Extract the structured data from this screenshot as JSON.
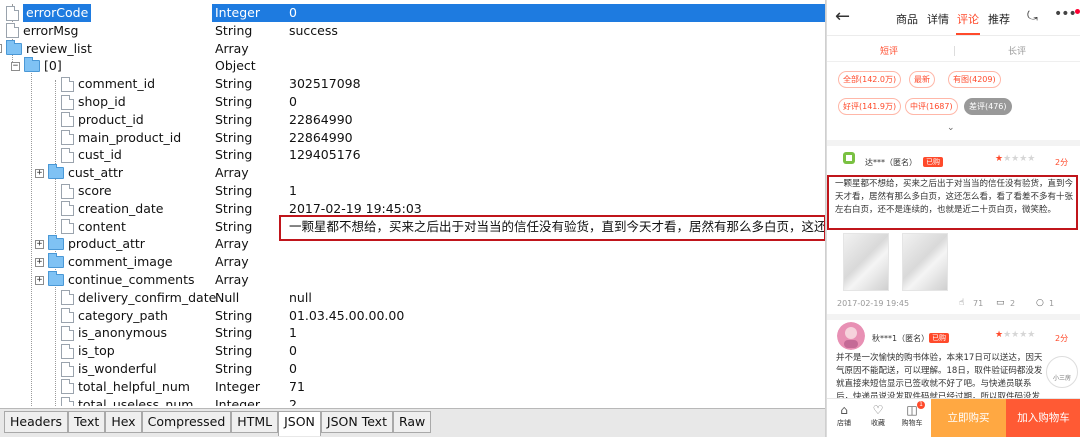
{
  "json_viewer": {
    "rows": [
      {
        "key": "errorCode",
        "type": "Integer",
        "value": "0"
      },
      {
        "key": "errorMsg",
        "type": "String",
        "value": "success"
      },
      {
        "key": "review_list",
        "type": "Array",
        "value": ""
      },
      {
        "key": "[0]",
        "type": "Object",
        "value": ""
      },
      {
        "key": "comment_id",
        "type": "String",
        "value": "302517098"
      },
      {
        "key": "shop_id",
        "type": "String",
        "value": "0"
      },
      {
        "key": "product_id",
        "type": "String",
        "value": "22864990"
      },
      {
        "key": "main_product_id",
        "type": "String",
        "value": "22864990"
      },
      {
        "key": "cust_id",
        "type": "String",
        "value": "129405176"
      },
      {
        "key": "cust_attr",
        "type": "Array",
        "value": ""
      },
      {
        "key": "score",
        "type": "String",
        "value": "1"
      },
      {
        "key": "creation_date",
        "type": "String",
        "value": "2017-02-19 19:45:03"
      },
      {
        "key": "content",
        "type": "String",
        "value": "一颗星都不想给，买来之后出于对当当的信任没有验货，直到今天才看，居然有那么多白页，这还怎么"
      },
      {
        "key": "product_attr",
        "type": "Array",
        "value": ""
      },
      {
        "key": "comment_image",
        "type": "Array",
        "value": ""
      },
      {
        "key": "continue_comments",
        "type": "Array",
        "value": ""
      },
      {
        "key": "delivery_confirm_date",
        "type": "Null",
        "value": "null"
      },
      {
        "key": "category_path",
        "type": "String",
        "value": "01.03.45.00.00.00"
      },
      {
        "key": "is_anonymous",
        "type": "String",
        "value": "1"
      },
      {
        "key": "is_top",
        "type": "String",
        "value": "0"
      },
      {
        "key": "is_wonderful",
        "type": "String",
        "value": "0"
      },
      {
        "key": "total_helpful_num",
        "type": "Integer",
        "value": "71"
      },
      {
        "key": "total_useless_num",
        "type": "Integer",
        "value": "2"
      }
    ],
    "tabs": [
      "Headers",
      "Text",
      "Hex",
      "Compressed",
      "HTML",
      "JSON",
      "JSON Text",
      "Raw"
    ],
    "active_tab": "JSON"
  },
  "app": {
    "nav": {
      "items": [
        "商品",
        "详情",
        "评论",
        "推荐"
      ],
      "active": "评论"
    },
    "subtabs": {
      "short": "短评",
      "long": "长评"
    },
    "filters": [
      {
        "label": "全部(142.0万)"
      },
      {
        "label": "最新"
      },
      {
        "label": "有图(4209)"
      },
      {
        "label": "好评(141.9万)"
      },
      {
        "label": "中评(1687)"
      },
      {
        "label": "差评(476)"
      }
    ],
    "review1": {
      "user": "达***（匿名）",
      "badge": "已购",
      "score": "2分",
      "stars_on": 1,
      "text": "一颗星都不想给，买来之后出于对当当的信任没有验货，直到今天才看，居然有那么多白页，这还怎么看，看了看差不多有十张左右白页，还不是连续的，也就是近二十页白页，微笑脸。",
      "date": "2017-02-19 19:45",
      "likes": "71",
      "comments": "2",
      "replies": "1"
    },
    "review2": {
      "user": "秋***1（匿名）",
      "badge": "已购",
      "score": "2分",
      "stars_on": 1,
      "text": "并不是一次愉快的购书体验，本来17日可以送达，因天气原因不能配送，可以理解。18日，取件验证码都没发就直接来短信显示已签收就不好了吧。与快递员联系后，快递员说没发取件码就已经过期，所以取件码没发过来……"
    },
    "float_button": "小三房",
    "bottom": {
      "shop": "店铺",
      "fav": "收藏",
      "cart": "购物车",
      "cart_count": "1",
      "buy_now": "立即购买",
      "add_cart": "加入购物车"
    }
  }
}
